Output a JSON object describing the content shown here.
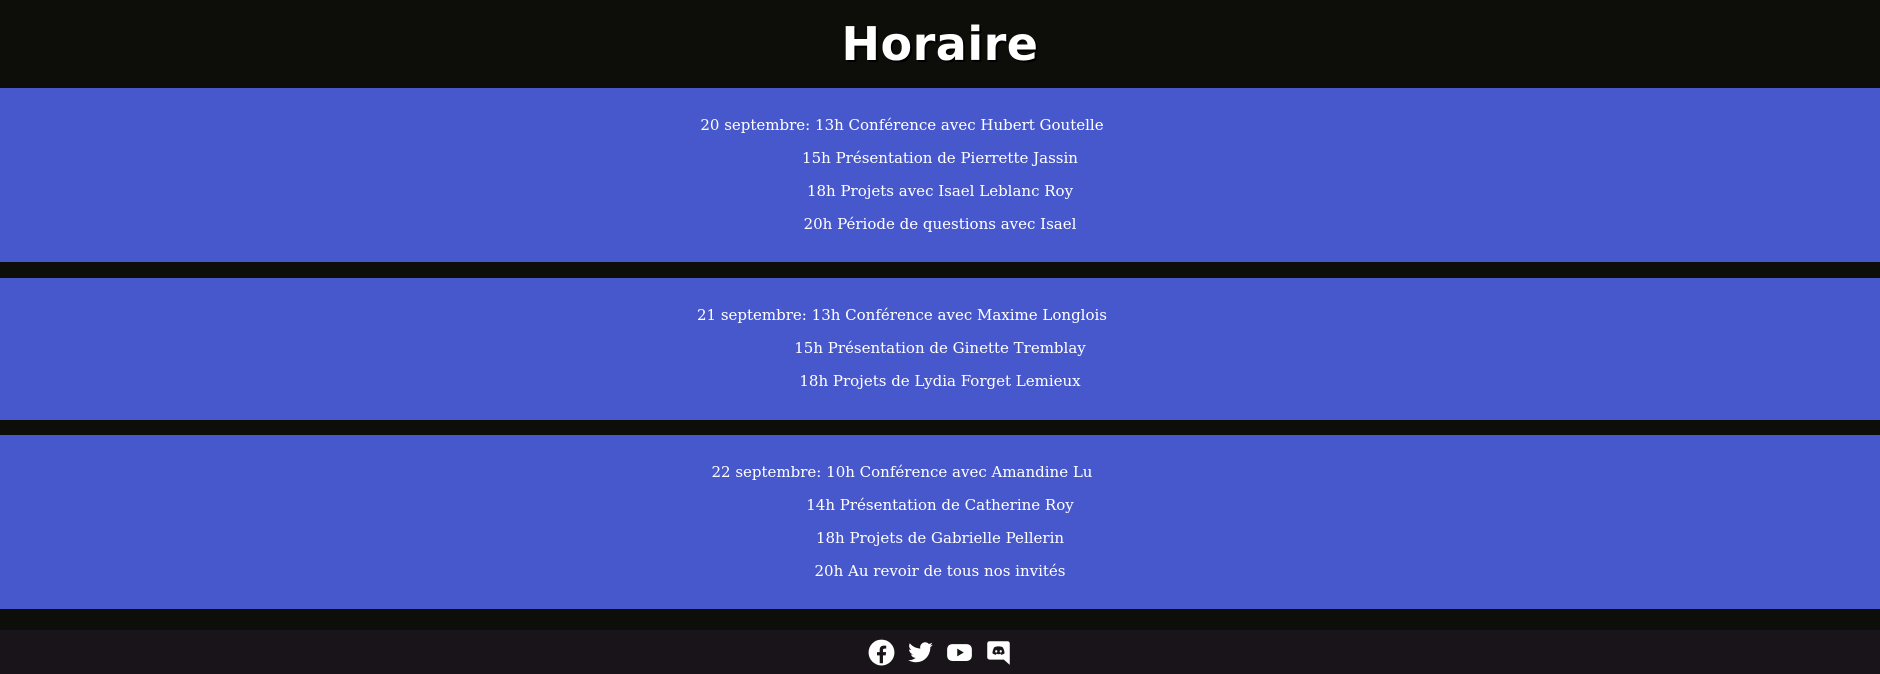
{
  "header": {
    "title": "Horaire"
  },
  "schedule": [
    {
      "date_label": "20 septembre:",
      "lines": [
        "13h Conférence avec Hubert Goutelle",
        "15h Présentation de Pierrette Jassin",
        "18h Projets avec Isael Leblanc Roy",
        "20h Période de questions avec Isael"
      ]
    },
    {
      "date_label": "21 septembre:",
      "lines": [
        "13h Conférence avec Maxime Longlois",
        "15h Présentation de Ginette Tremblay",
        "18h Projets de Lydia Forget Lemieux"
      ]
    },
    {
      "date_label": "22 septembre:",
      "lines": [
        "10h Conférence avec Amandine Lu",
        "14h Présentation de Catherine Roy",
        "18h Projets de Gabrielle Pellerin",
        "20h Au revoir de tous nos invités"
      ]
    }
  ],
  "footer": {
    "icons": [
      "facebook-icon",
      "twitter-icon",
      "youtube-icon",
      "discord-icon"
    ]
  },
  "colors": {
    "background": "#0d0e09",
    "band": "#4757cc",
    "footer": "#19131a",
    "text": "#ffffff"
  }
}
